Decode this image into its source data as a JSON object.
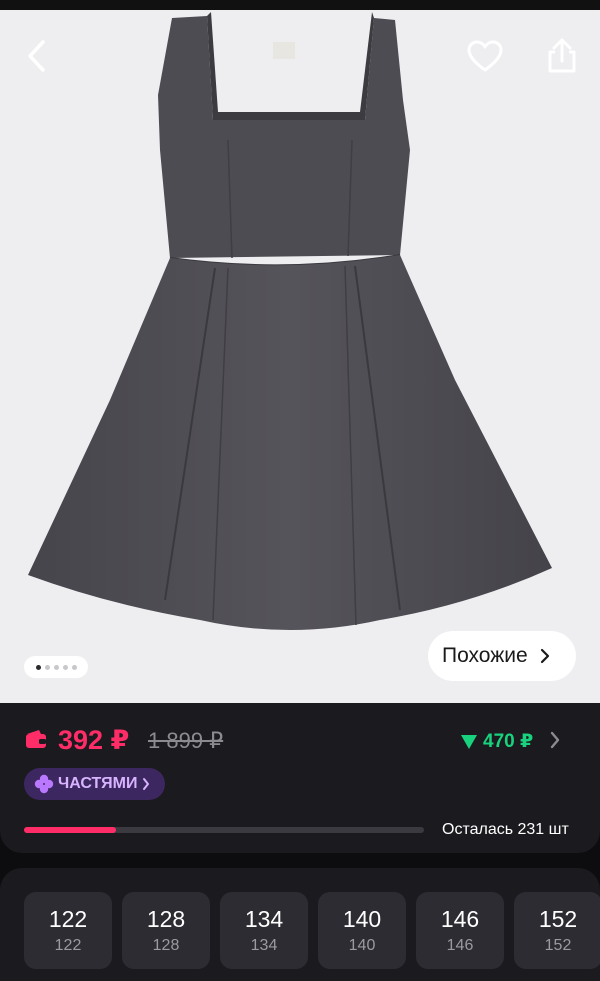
{
  "product": {
    "image_icon": "dress-photo",
    "gallery": {
      "count": 5,
      "active_index": 0
    },
    "similar_label": "Похожие"
  },
  "header": {
    "back_icon": "chevron-left-icon",
    "favorite_icon": "heart-icon",
    "share_icon": "share-icon"
  },
  "pricing": {
    "price": "392 ₽",
    "old_price": "1 899 ₽",
    "bonus": "470 ₽",
    "installments_label": "ЧАСТЯМИ",
    "remaining_text": "Осталась 231 шт",
    "remaining_progress": 0.23,
    "colors": {
      "price": "#ff2d67",
      "bonus": "#18d27d",
      "installments": "#d8b3ff"
    }
  },
  "sizes": [
    {
      "label": "122",
      "sub": "122"
    },
    {
      "label": "128",
      "sub": "128"
    },
    {
      "label": "134",
      "sub": "134"
    },
    {
      "label": "140",
      "sub": "140"
    },
    {
      "label": "146",
      "sub": "146"
    },
    {
      "label": "152",
      "sub": "152"
    }
  ]
}
